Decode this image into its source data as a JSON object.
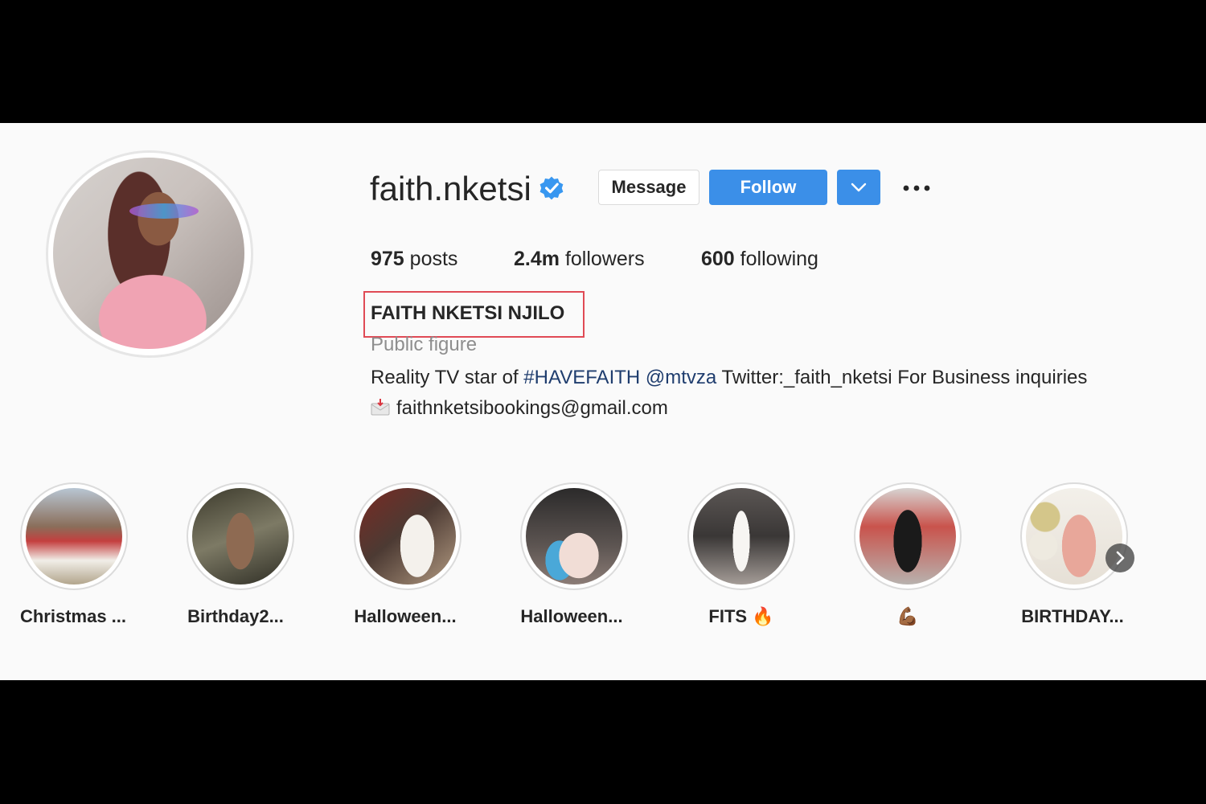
{
  "profile": {
    "username": "faith.nketsi",
    "verified": true,
    "full_name": "FAITH NKETSI NJILO",
    "category": "Public figure",
    "bio": {
      "prefix": "Reality TV star of ",
      "hashtag": "#HAVEFAITH",
      "mention": "@mtvza",
      "suffix": " Twitter:_faith_nketsi For Business inquiries",
      "email": "faithnketsibookings@gmail.com"
    }
  },
  "actions": {
    "message_label": "Message",
    "follow_label": "Follow"
  },
  "stats": {
    "posts_count": "975",
    "posts_label": "posts",
    "followers_count": "2.4m",
    "followers_label": "followers",
    "following_count": "600",
    "following_label": "following"
  },
  "highlights": [
    {
      "label": "Christmas ..."
    },
    {
      "label": "Birthday2..."
    },
    {
      "label": "Halloween..."
    },
    {
      "label": "Halloween..."
    },
    {
      "label": "FITS 🔥"
    },
    {
      "label": "💪🏾"
    },
    {
      "label": "BIRTHDAY..."
    }
  ],
  "colors": {
    "accent": "#3b8fe8",
    "annotation_box": "#e04a55",
    "link": "#1f3d6e",
    "verified_badge": "#3897f0"
  },
  "icons": {
    "verified": "verified-badge-icon",
    "dropdown": "chevron-down-icon",
    "more": "more-options-icon",
    "email": "envelope-icon",
    "next": "chevron-right-icon"
  }
}
